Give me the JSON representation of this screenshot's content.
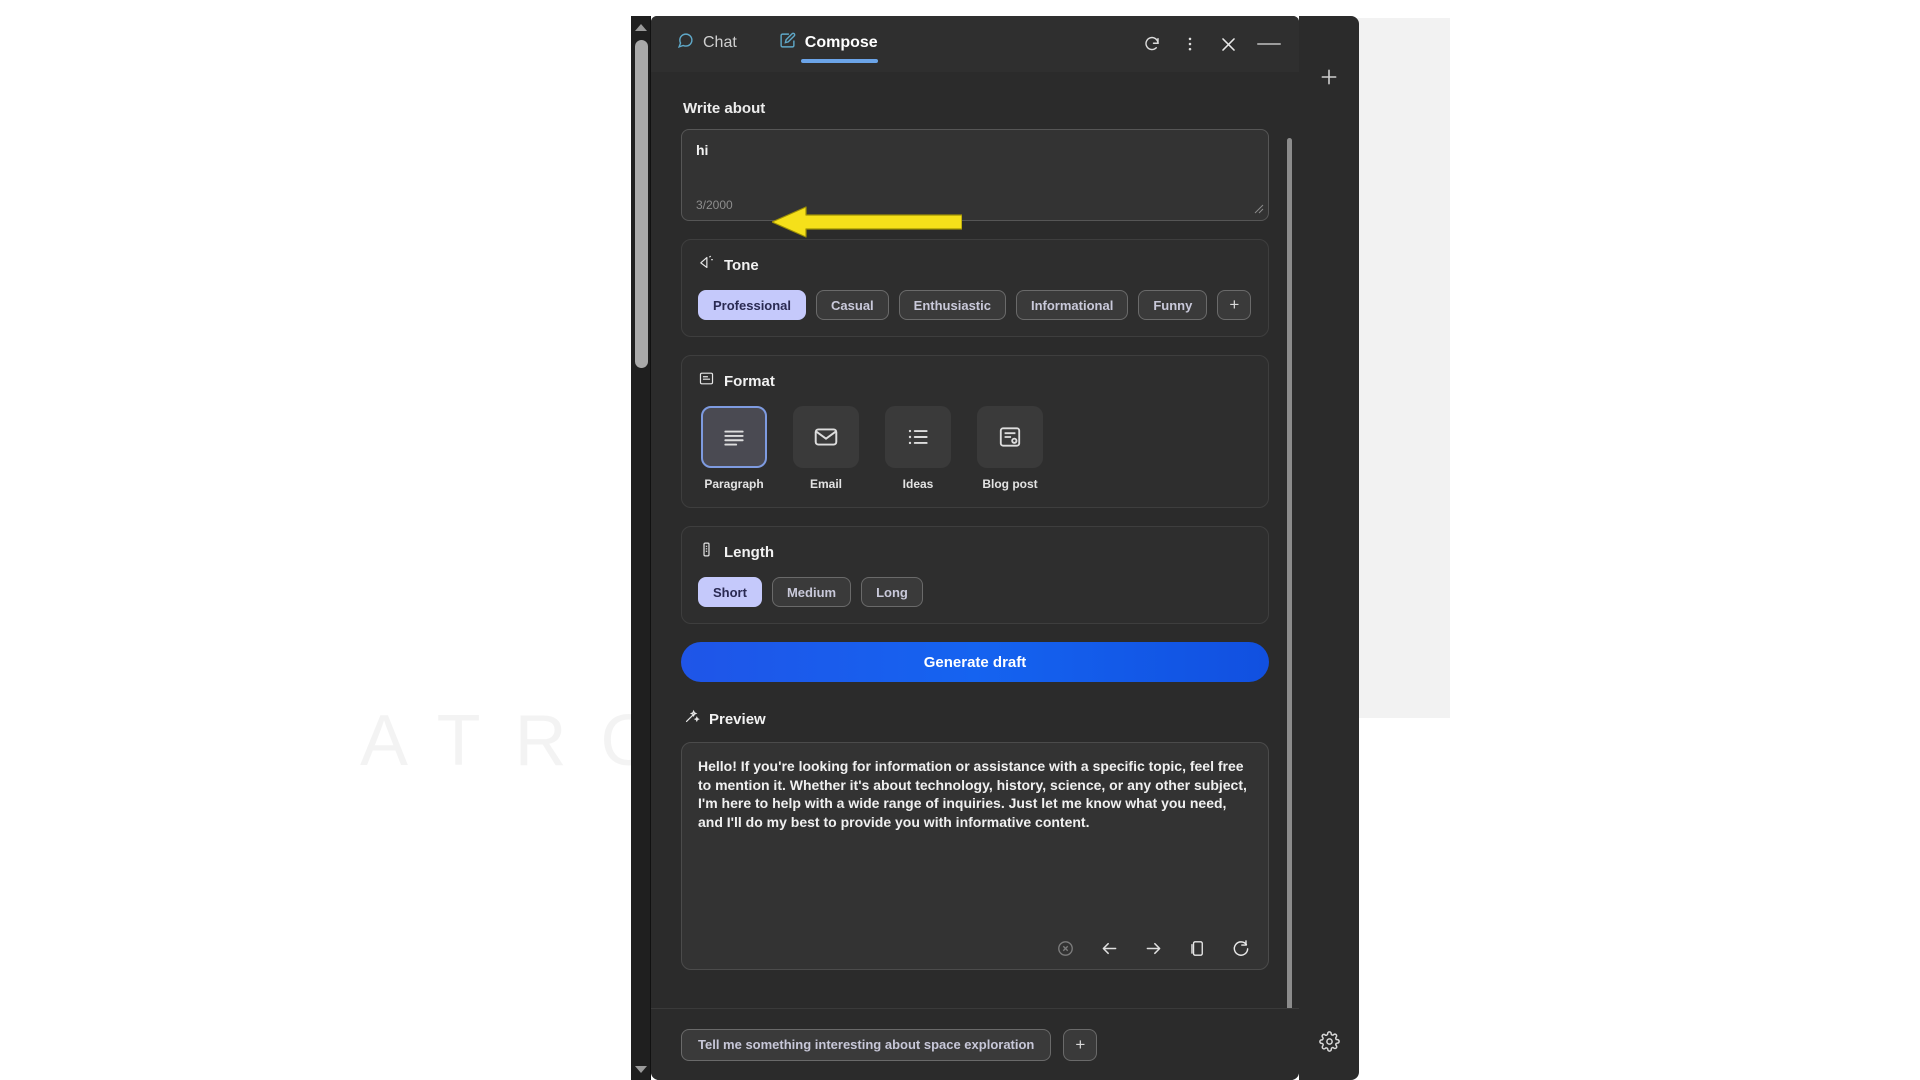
{
  "window": {
    "tabs": [
      {
        "id": "chat",
        "label": "Chat",
        "icon": "chat-bubble-icon",
        "active": false
      },
      {
        "id": "compose",
        "label": "Compose",
        "icon": "compose-pencil-icon",
        "active": true
      }
    ],
    "actions": [
      {
        "id": "refresh",
        "icon": "refresh-icon",
        "tooltip": "Refresh"
      },
      {
        "id": "more",
        "icon": "more-vertical-icon",
        "tooltip": "More options"
      },
      {
        "id": "close",
        "icon": "close-icon",
        "tooltip": "Close"
      },
      {
        "id": "minimize",
        "icon": "minimize-dash-icon",
        "tooltip": "Minimize"
      }
    ]
  },
  "write_about": {
    "label": "Write about",
    "value": "hi",
    "placeholder": "Write about",
    "counter": "3/2000",
    "max_chars": 2000
  },
  "tone": {
    "title": "Tone",
    "icon": "tone-megaphone-icon",
    "options": [
      {
        "label": "Professional",
        "selected": true
      },
      {
        "label": "Casual",
        "selected": false
      },
      {
        "label": "Enthusiastic",
        "selected": false
      },
      {
        "label": "Informational",
        "selected": false
      },
      {
        "label": "Funny",
        "selected": false
      }
    ],
    "add_label": "+"
  },
  "format": {
    "title": "Format",
    "icon": "format-document-icon",
    "options": [
      {
        "label": "Paragraph",
        "icon": "paragraph-lines-icon",
        "selected": true
      },
      {
        "label": "Email",
        "icon": "envelope-icon",
        "selected": false
      },
      {
        "label": "Ideas",
        "icon": "bullet-list-icon",
        "selected": false
      },
      {
        "label": "Blog post",
        "icon": "blog-post-icon",
        "selected": false
      }
    ]
  },
  "length": {
    "title": "Length",
    "icon": "length-gauge-icon",
    "options": [
      {
        "label": "Short",
        "selected": true
      },
      {
        "label": "Medium",
        "selected": false
      },
      {
        "label": "Long",
        "selected": false
      }
    ]
  },
  "generate": {
    "label": "Generate draft"
  },
  "preview": {
    "title": "Preview",
    "icon": "magic-wand-icon",
    "text": "Hello! If you're looking for information or assistance with a specific topic, feel free to mention it. Whether it's about technology, history, science, or any other subject, I'm here to help with a wide range of inquiries. Just let me know what you need, and I'll do my best to provide you with informative content.",
    "actions": [
      {
        "id": "stop",
        "icon": "stop-circle-icon",
        "dimmed": true
      },
      {
        "id": "previous",
        "icon": "arrow-left-icon",
        "dimmed": false
      },
      {
        "id": "next",
        "icon": "arrow-right-icon",
        "dimmed": false
      },
      {
        "id": "copy",
        "icon": "copy-icon",
        "dimmed": false
      },
      {
        "id": "regenerate",
        "icon": "regenerate-icon",
        "dimmed": false
      }
    ]
  },
  "suggestions": {
    "chips": [
      "Tell me something interesting about space exploration"
    ],
    "add_label": "+"
  },
  "rail": {
    "top": {
      "icon": "plus-icon",
      "label": "New"
    },
    "bottom": {
      "icon": "gear-icon",
      "label": "Settings"
    }
  },
  "watermark": {
    "word": "ATRO ACADEMY"
  },
  "annotation": {
    "type": "arrow",
    "color": "#F5E01A",
    "points_to": "3/2000"
  },
  "colors": {
    "accent_blue": "#1563f0",
    "tab_underline": "#6ba4e8",
    "chip_selected_bg": "#c5c9fb",
    "panel_bg": "#2b2b2b",
    "card_bg": "#333333",
    "annotation_yellow": "#F5E01A"
  }
}
